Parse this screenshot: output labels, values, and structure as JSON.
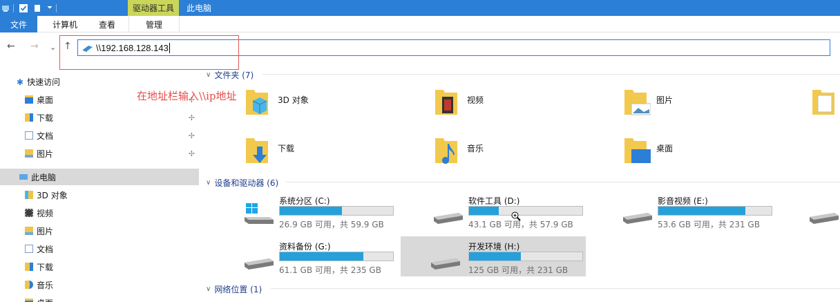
{
  "title_bar": {
    "context_tab": "驱动器工具",
    "window_title": "此电脑"
  },
  "ribbon": {
    "tabs": [
      "文件",
      "计算机",
      "查看",
      "管理"
    ]
  },
  "nav": {
    "back": "←",
    "forward": "→",
    "recent": "⌄",
    "up": "↑"
  },
  "address": {
    "value": "\\\\192.168.128.143"
  },
  "annotation": "在地址栏输入\\\\ip地址",
  "sidebar": {
    "quick_access": "快速访问",
    "quick_items": [
      "桌面",
      "下载",
      "文档",
      "图片"
    ],
    "this_pc": "此电脑",
    "pc_items": [
      "3D 对象",
      "视频",
      "图片",
      "文档",
      "下载",
      "音乐",
      "桌面"
    ]
  },
  "main": {
    "folders_header": "文件夹 (7)",
    "folders": [
      "3D 对象",
      "视频",
      "图片",
      "下载",
      "音乐",
      "桌面"
    ],
    "devices_header": "设备和驱动器 (6)",
    "drives": [
      {
        "name": "系统分区 (C:)",
        "size": "26.9 GB 可用，共 59.9 GB",
        "used": 0.55
      },
      {
        "name": "软件工具 (D:)",
        "size": "43.1 GB 可用，共 57.9 GB",
        "used": 0.26
      },
      {
        "name": "影音视频 (E:)",
        "size": "53.6 GB 可用，共 231 GB",
        "used": 0.77
      },
      {
        "name": "资料备份 (G:)",
        "size": "61.1 GB 可用，共 235 GB",
        "used": 0.74
      },
      {
        "name": "开发环境 (H:)",
        "size": "125 GB 可用，共 231 GB",
        "used": 0.46
      }
    ],
    "network_header": "网络位置 (1)"
  },
  "colors": {
    "accent": "#2b7fd6",
    "context_tab": "#c9d65a",
    "drive_bar": "#26a0da",
    "annotation": "#e84a4a"
  }
}
